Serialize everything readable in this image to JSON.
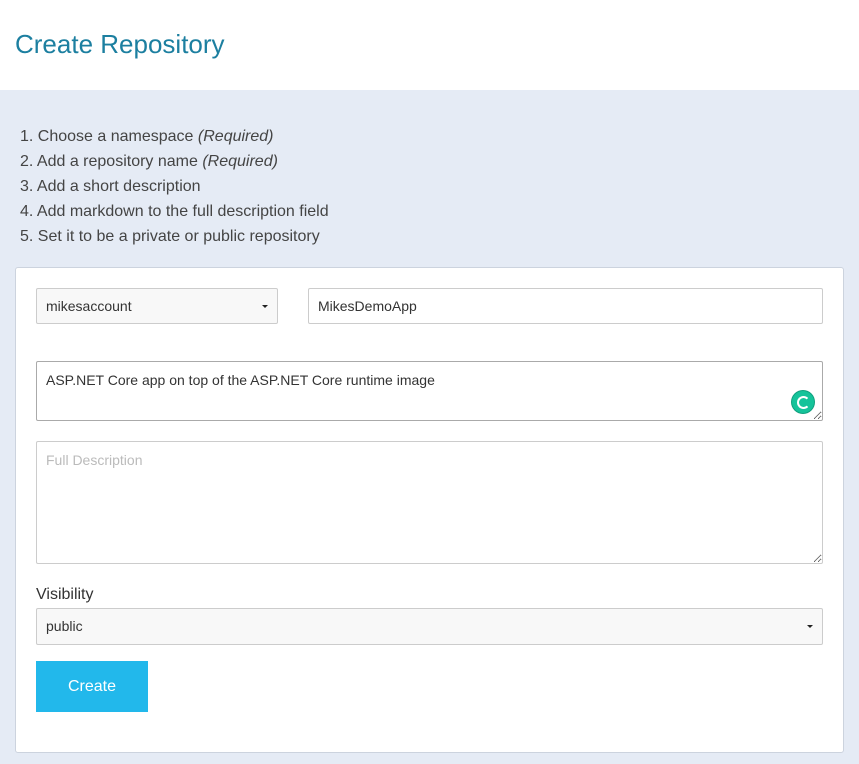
{
  "header": {
    "title": "Create Repository"
  },
  "steps": [
    {
      "number": "1.",
      "text": "Choose a namespace",
      "note": "(Required)"
    },
    {
      "number": "2.",
      "text": "Add a repository name",
      "note": "(Required)"
    },
    {
      "number": "3.",
      "text": "Add a short description",
      "note": ""
    },
    {
      "number": "4.",
      "text": "Add markdown to the full description field",
      "note": ""
    },
    {
      "number": "5.",
      "text": "Set it to be a private or public repository",
      "note": ""
    }
  ],
  "form": {
    "namespace": {
      "value": "mikesaccount"
    },
    "repo_name": {
      "value": "MikesDemoApp"
    },
    "short_description": {
      "value": "ASP.NET Core app on top of the ASP.NET Core runtime image"
    },
    "full_description": {
      "value": "",
      "placeholder": "Full Description"
    },
    "visibility": {
      "label": "Visibility",
      "value": "public"
    },
    "create_label": "Create"
  },
  "icons": {
    "grammar_indicator": "grammar-check-icon",
    "grammar_color": "#15c39a",
    "dropdown": "caret-down-icon"
  },
  "colors": {
    "title": "#1c7fa0",
    "background": "#e5ebf5",
    "button": "#22b8eb"
  }
}
